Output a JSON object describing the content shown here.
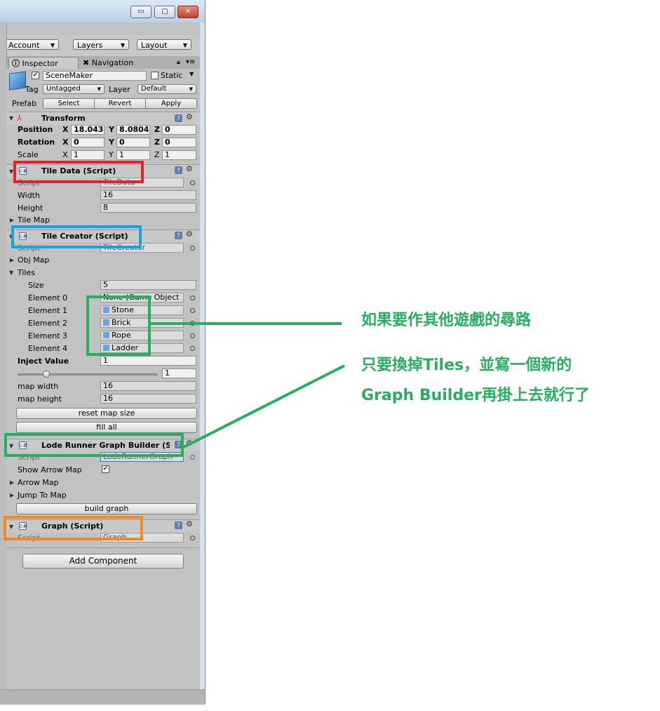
{
  "window": {
    "minimize": "▭",
    "maximize": "▢",
    "close": "✕"
  },
  "toolbar": {
    "account": "Account",
    "layers": "Layers",
    "layout": "Layout"
  },
  "tabs": {
    "inspector": "Inspector",
    "navigation": "Navigation"
  },
  "gameobject": {
    "name": "SceneMaker",
    "static_label": "Static",
    "tag_label": "Tag",
    "tag_value": "Untagged",
    "layer_label": "Layer",
    "layer_value": "Default",
    "prefab_label": "Prefab",
    "select": "Select",
    "revert": "Revert",
    "apply": "Apply"
  },
  "transform": {
    "title": "Transform",
    "position_label": "Position",
    "rotation_label": "Rotation",
    "scale_label": "Scale",
    "axis_x": "X",
    "axis_y": "Y",
    "axis_z": "Z",
    "position": {
      "x": "18.043",
      "y": "8.0804",
      "z": "0"
    },
    "rotation": {
      "x": "0",
      "y": "0",
      "z": "0"
    },
    "scale": {
      "x": "1",
      "y": "1",
      "z": "1"
    }
  },
  "tile_data": {
    "title": "Tile Data (Script)",
    "script_label": "Script",
    "script_value": "TileData",
    "width_label": "Width",
    "width_value": "16",
    "height_label": "Height",
    "height_value": "8",
    "tilemap_label": "Tile Map"
  },
  "tile_creator": {
    "title": "Tile Creator (Script)",
    "script_label": "Script",
    "script_value": "TileCreator",
    "objmap_label": "Obj Map",
    "tiles_label": "Tiles",
    "size_label": "Size",
    "size_value": "5",
    "elements": [
      {
        "label": "Element 0",
        "value": "None (Game Object"
      },
      {
        "label": "Element 1",
        "value": "Stone"
      },
      {
        "label": "Element 2",
        "value": "Brick"
      },
      {
        "label": "Element 3",
        "value": "Rope"
      },
      {
        "label": "Element 4",
        "value": "Ladder"
      }
    ],
    "inject_label": "Inject Value",
    "inject_value": "1",
    "slider_value": 1,
    "slider_display": "1",
    "map_width_label": "map width",
    "map_width_value": "16",
    "map_height_label": "map height",
    "map_height_value": "16",
    "reset_button": "reset map size",
    "fill_button": "fill all"
  },
  "graph_builder": {
    "title": "Lode Runner Graph Builder (S",
    "script_label": "Script",
    "script_value": "LodeRunnerGraph",
    "show_arrow_label": "Show Arrow Map",
    "show_arrow_checked": "✔",
    "arrow_map_label": "Arrow Map",
    "jump_map_label": "Jump To Map",
    "build_button": "build graph"
  },
  "graph": {
    "title": "Graph (Script)",
    "script_label": "Script",
    "script_value": "Graph"
  },
  "add_component": "Add Component",
  "annotations": {
    "line1": "如果要作其他遊戲的尋路",
    "line2": "只要換掉Tiles，並寫一個新的",
    "line3": "Graph Builder再掛上去就行了"
  },
  "colors": {
    "red": "#e0242d",
    "blue": "#1ba1e2",
    "green": "#27ae60",
    "orange": "#f08a24"
  }
}
